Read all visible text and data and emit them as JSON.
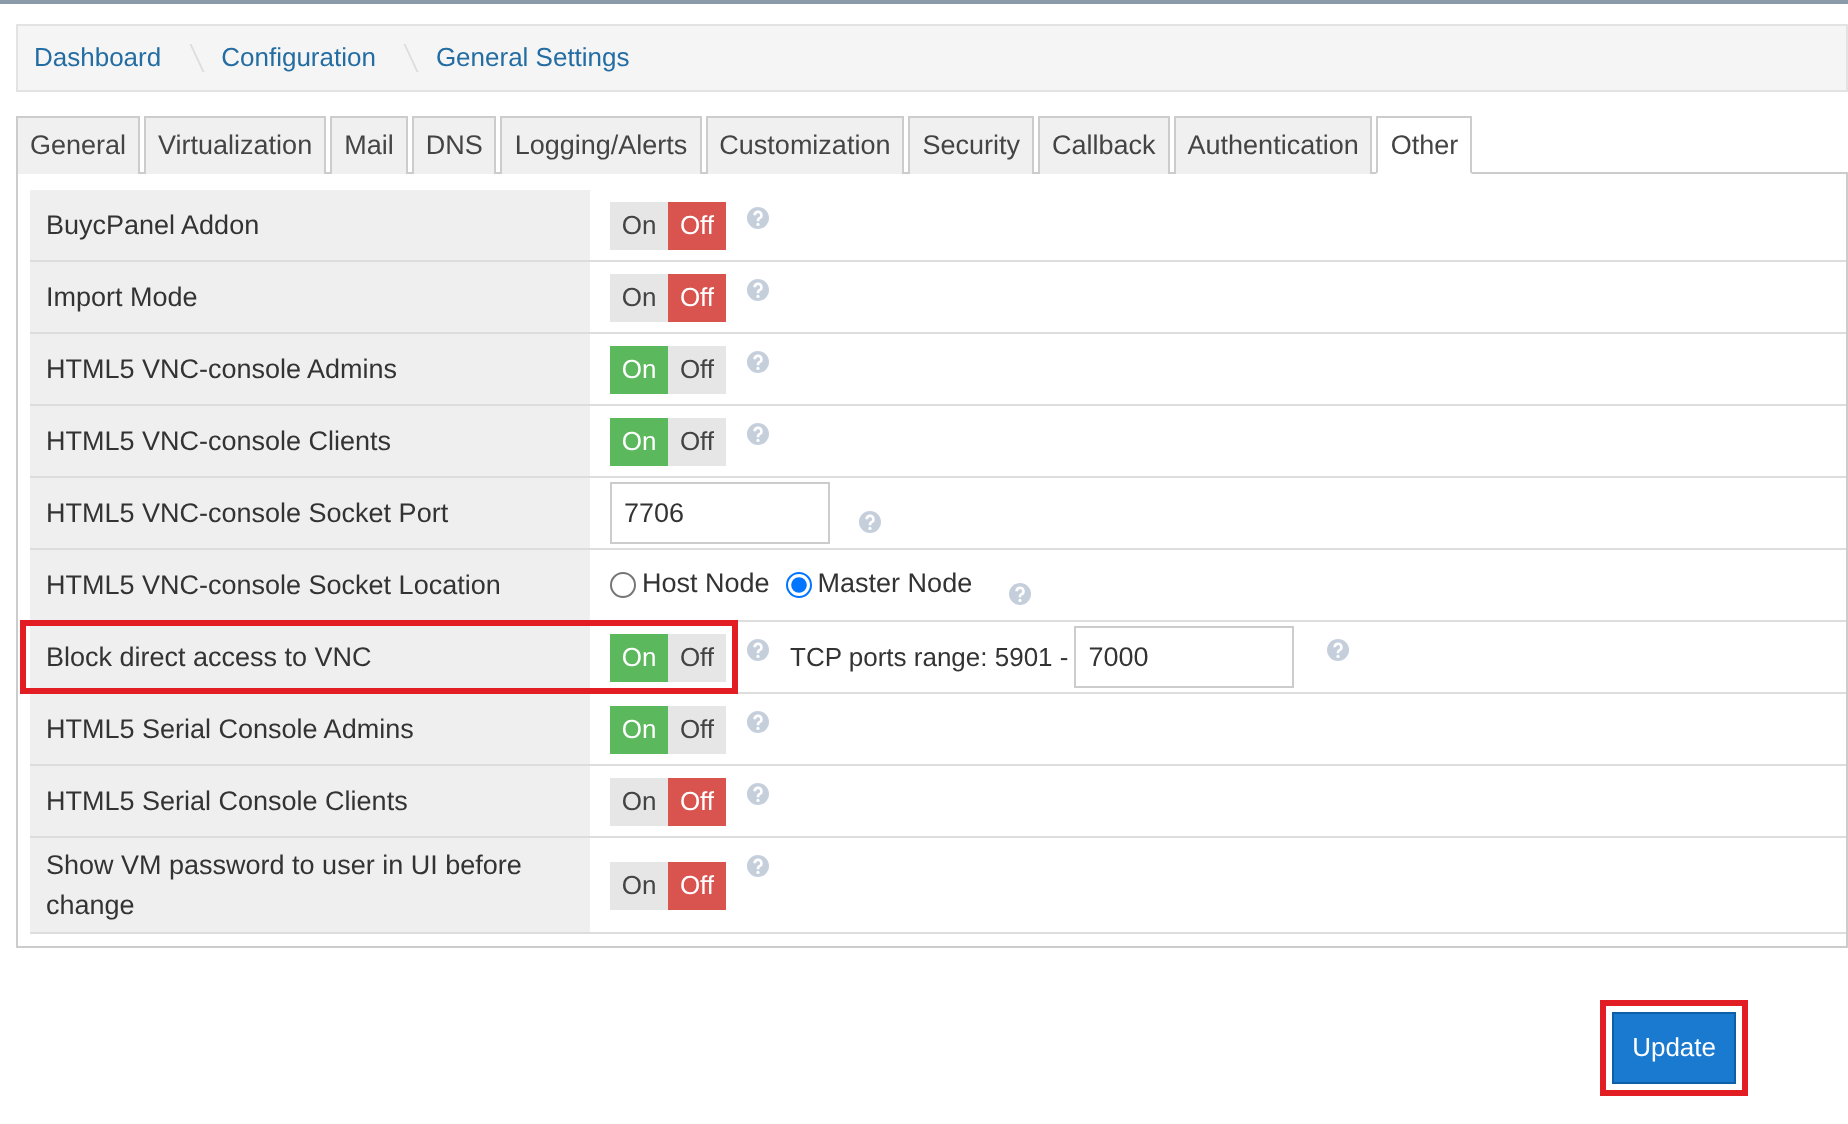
{
  "breadcrumb": [
    {
      "label": "Dashboard"
    },
    {
      "label": "Configuration"
    },
    {
      "label": "General Settings"
    }
  ],
  "tabs": [
    {
      "label": "General",
      "selected": false
    },
    {
      "label": "Virtualization",
      "selected": false
    },
    {
      "label": "Mail",
      "selected": false
    },
    {
      "label": "DNS",
      "selected": false
    },
    {
      "label": "Logging/Alerts",
      "selected": false
    },
    {
      "label": "Customization",
      "selected": false
    },
    {
      "label": "Security",
      "selected": false
    },
    {
      "label": "Callback",
      "selected": false
    },
    {
      "label": "Authentication",
      "selected": false
    },
    {
      "label": "Other",
      "selected": true
    }
  ],
  "settings": [
    {
      "kind": "toggle",
      "label": "BuycPanel Addon",
      "on_label": "On",
      "off_label": "Off",
      "on": false,
      "highlighted": false
    },
    {
      "kind": "toggle",
      "label": "Import Mode",
      "on_label": "On",
      "off_label": "Off",
      "on": false,
      "highlighted": false
    },
    {
      "kind": "toggle",
      "label": "HTML5 VNC-console Admins",
      "on_label": "On",
      "off_label": "Off",
      "on": true,
      "highlighted": false
    },
    {
      "kind": "toggle",
      "label": "HTML5 VNC-console Clients",
      "on_label": "On",
      "off_label": "Off",
      "on": true,
      "highlighted": false
    },
    {
      "kind": "input",
      "label": "HTML5 VNC-console Socket Port",
      "value": "7706",
      "highlighted": false
    },
    {
      "kind": "radio",
      "label": "HTML5 VNC-console Socket Location",
      "options": [
        {
          "label": "Host Node",
          "selected": false
        },
        {
          "label": "Master Node",
          "selected": true
        }
      ],
      "highlighted": false
    },
    {
      "kind": "toggle",
      "label": "Block direct access to VNC",
      "on_label": "On",
      "off_label": "Off",
      "on": true,
      "highlighted": true,
      "range_label": "TCP ports range: 5901 -",
      "range_value": "7000"
    },
    {
      "kind": "toggle",
      "label": "HTML5 Serial Console Admins",
      "on_label": "On",
      "off_label": "Off",
      "on": true,
      "highlighted": false
    },
    {
      "kind": "toggle",
      "label": "HTML5 Serial Console Clients",
      "on_label": "On",
      "off_label": "Off",
      "on": false,
      "highlighted": false
    },
    {
      "kind": "toggle",
      "label": "Show VM password to user in UI before change",
      "on_label": "On",
      "off_label": "Off",
      "on": false,
      "highlighted": false
    }
  ],
  "update_button": {
    "label": "Update",
    "highlighted": true
  }
}
